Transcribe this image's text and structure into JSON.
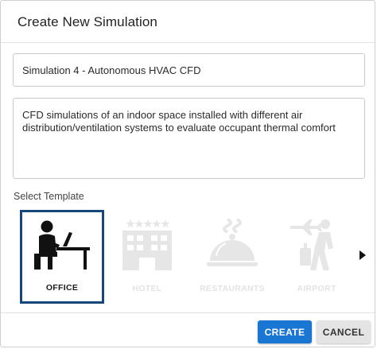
{
  "dialog": {
    "title": "Create New Simulation"
  },
  "form": {
    "name_value": "Simulation 4 - Autonomous HVAC CFD",
    "description_value": "CFD simulations of an indoor space installed with different air distribution/ventilation systems to evaluate occupant thermal comfort",
    "template_label": "Select Template"
  },
  "templates": [
    {
      "label": "OFFICE",
      "icon": "office-worker-icon",
      "state": "selected"
    },
    {
      "label": "HOTEL",
      "icon": "hotel-icon",
      "state": "disabled"
    },
    {
      "label": "RESTAURANTS",
      "icon": "cloche-icon",
      "state": "disabled"
    },
    {
      "label": "AIRPORT",
      "icon": "traveler-icon",
      "state": "disabled"
    }
  ],
  "carousel": {
    "next_icon": "chevron-right-icon"
  },
  "footer": {
    "create_label": "CREATE",
    "cancel_label": "CANCEL"
  },
  "colors": {
    "selected_border": "#17467a",
    "primary_button": "#1976d2",
    "secondary_button": "#e4e4e4",
    "disabled_icon": "#e6e6e6"
  }
}
